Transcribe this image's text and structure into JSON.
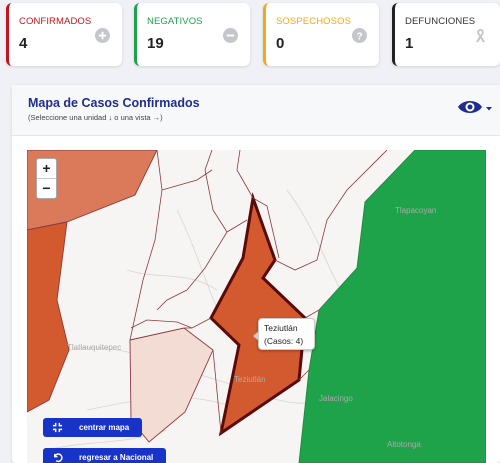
{
  "stats": {
    "confirmados": {
      "label": "CONFIRMADOS",
      "value": "4",
      "icon": "plus-circle-icon",
      "color": "#c0141e"
    },
    "negativos": {
      "label": "NEGATIVOS",
      "value": "19",
      "icon": "minus-circle-icon",
      "color": "#1fa34a"
    },
    "sospechosos": {
      "label": "SOSPECHOSOS",
      "value": "0",
      "icon": "question-circle-icon",
      "color": "#f0a91a"
    },
    "defunciones": {
      "label": "DEFUNCIONES",
      "value": "1",
      "icon": "ribbon-icon",
      "color": "#222222"
    }
  },
  "map_card": {
    "title": "Mapa de Casos Confirmados",
    "subtitle": "(Seleccione una unidad ↓ o una vista →)",
    "view_icon": "eye-icon"
  },
  "map": {
    "zoom_in": "+",
    "zoom_out": "−",
    "place_labels": {
      "tlatlauquitepec": "Tlatlauquitepec",
      "tlapacoyan": "Tlapacoyan",
      "jalacingo": "Jalacingo",
      "altotonga": "Altotonga",
      "teziutlan_city": "Teziutlán"
    },
    "tooltip": {
      "name": "Teziutlán",
      "cases": "(Casos: 4)"
    },
    "buttons": {
      "centrar": "centrar mapa",
      "regresar": "regresar a Nacional"
    },
    "colors": {
      "high": "#d35a2e",
      "medium": "#db7a5a",
      "low": "#f3dcd3",
      "negative": "#1fa34a",
      "border": "#8b3a3a",
      "selected_border": "#5b0a0a"
    }
  }
}
